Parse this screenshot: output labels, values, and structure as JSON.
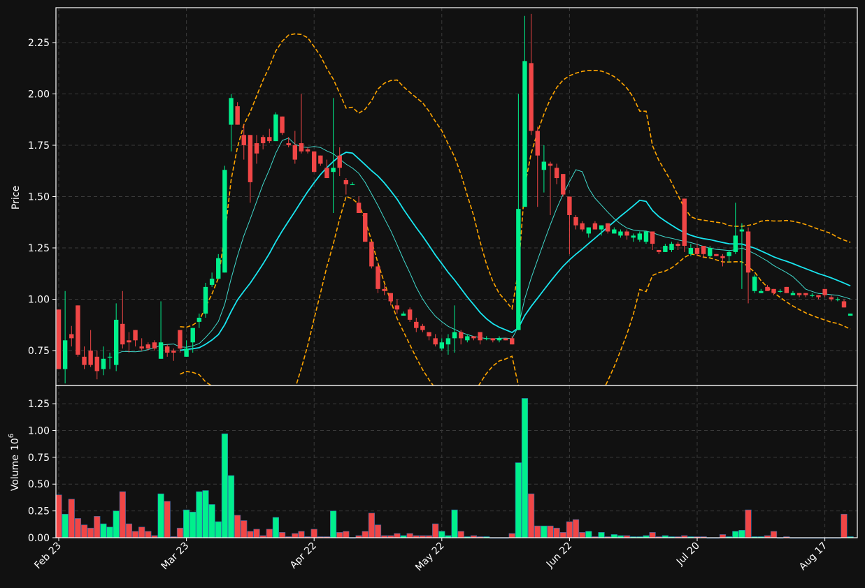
{
  "chart_data": {
    "type": "candlestick",
    "panels": [
      "price",
      "volume"
    ],
    "price_axis": {
      "label": "Price",
      "ticks": [
        "0.75",
        "1.00",
        "1.25",
        "1.50",
        "1.75",
        "2.00",
        "2.25"
      ],
      "ylim": [
        0.58,
        2.42
      ]
    },
    "volume_axis": {
      "label": "Volume",
      "exponent": "10",
      "exponent_power": "6",
      "ticks": [
        "0.00",
        "0.25",
        "0.50",
        "0.75",
        "1.00",
        "1.25"
      ],
      "ylim": [
        0,
        1.42
      ]
    },
    "x_ticks": [
      {
        "label": "Feb 23",
        "index": 0
      },
      {
        "label": "Mar 23",
        "index": 20
      },
      {
        "label": "Apr 22",
        "index": 40
      },
      {
        "label": "May 22",
        "index": 60
      },
      {
        "label": "Jun 22",
        "index": 80
      },
      {
        "label": "Jul 20",
        "index": 100
      },
      {
        "label": "Aug 17",
        "index": 120
      }
    ],
    "colors": {
      "up": "#00f08c",
      "down": "#f04646",
      "ma_slow": "#19e6f0",
      "ma_fast": "#40d9cc",
      "bands": "#ffa500",
      "background": "#111111"
    },
    "candles": [
      [
        0.95,
        0.95,
        0.66,
        0.66,
        0.4
      ],
      [
        0.66,
        1.04,
        0.59,
        0.8,
        0.22
      ],
      [
        0.83,
        0.87,
        0.77,
        0.81,
        0.36
      ],
      [
        0.97,
        0.97,
        0.72,
        0.73,
        0.18
      ],
      [
        0.72,
        0.77,
        0.66,
        0.68,
        0.12
      ],
      [
        0.75,
        0.85,
        0.67,
        0.68,
        0.09
      ],
      [
        0.72,
        0.75,
        0.61,
        0.65,
        0.2
      ],
      [
        0.66,
        0.77,
        0.63,
        0.71,
        0.13
      ],
      [
        0.72,
        0.74,
        0.66,
        0.72,
        0.1
      ],
      [
        0.68,
        0.98,
        0.65,
        0.9,
        0.25
      ],
      [
        0.88,
        1.04,
        0.76,
        0.78,
        0.43
      ],
      [
        0.8,
        0.84,
        0.74,
        0.79,
        0.13
      ],
      [
        0.85,
        0.85,
        0.77,
        0.8,
        0.06
      ],
      [
        0.77,
        0.81,
        0.75,
        0.76,
        0.1
      ],
      [
        0.78,
        0.79,
        0.75,
        0.76,
        0.06
      ],
      [
        0.79,
        0.8,
        0.75,
        0.76,
        0.02
      ],
      [
        0.71,
        0.99,
        0.71,
        0.79,
        0.41
      ],
      [
        0.77,
        0.78,
        0.72,
        0.74,
        0.34
      ],
      [
        0.75,
        0.76,
        0.7,
        0.74,
        0.01
      ],
      [
        0.85,
        0.85,
        0.74,
        0.76,
        0.09
      ],
      [
        0.72,
        0.8,
        0.72,
        0.76,
        0.26
      ],
      [
        0.79,
        0.86,
        0.74,
        0.86,
        0.24
      ],
      [
        0.89,
        0.93,
        0.86,
        0.91,
        0.43
      ],
      [
        0.93,
        1.08,
        0.91,
        1.06,
        0.44
      ],
      [
        1.07,
        1.13,
        1.06,
        1.1,
        0.31
      ],
      [
        1.1,
        1.22,
        1.1,
        1.2,
        0.15
      ],
      [
        1.13,
        1.65,
        1.13,
        1.63,
        0.97
      ],
      [
        1.85,
        2.0,
        1.72,
        1.98,
        0.58
      ],
      [
        1.94,
        1.96,
        1.85,
        1.85,
        0.21
      ],
      [
        1.8,
        1.85,
        1.68,
        1.75,
        0.16
      ],
      [
        1.8,
        1.8,
        1.47,
        1.57,
        0.06
      ],
      [
        1.76,
        1.8,
        1.66,
        1.71,
        0.08
      ],
      [
        1.79,
        1.8,
        1.73,
        1.76,
        0.02
      ],
      [
        1.79,
        1.83,
        1.76,
        1.77,
        0.08
      ],
      [
        1.77,
        1.91,
        1.77,
        1.9,
        0.19
      ],
      [
        1.89,
        1.89,
        1.8,
        1.81,
        0.05
      ],
      [
        1.76,
        1.79,
        1.74,
        1.75,
        0.01
      ],
      [
        1.75,
        1.82,
        1.66,
        1.68,
        0.04
      ],
      [
        1.76,
        2.0,
        1.71,
        1.72,
        0.06
      ],
      [
        1.73,
        1.74,
        1.71,
        1.72,
        0.01
      ],
      [
        1.72,
        1.72,
        1.62,
        1.62,
        0.08
      ],
      [
        1.7,
        1.7,
        1.65,
        1.66,
        0.01
      ],
      [
        1.64,
        1.68,
        1.59,
        1.59,
        0.01
      ],
      [
        1.62,
        1.98,
        1.42,
        1.64,
        0.25
      ],
      [
        1.7,
        1.74,
        1.6,
        1.64,
        0.05
      ],
      [
        1.58,
        1.59,
        1.51,
        1.56,
        0.06
      ],
      [
        1.56,
        1.57,
        1.56,
        1.56,
        0.0
      ],
      [
        1.47,
        1.5,
        1.42,
        1.42,
        0.02
      ],
      [
        1.42,
        1.42,
        1.28,
        1.28,
        0.06
      ],
      [
        1.28,
        1.28,
        1.15,
        1.16,
        0.23
      ],
      [
        1.16,
        1.18,
        1.03,
        1.05,
        0.12
      ],
      [
        1.05,
        1.07,
        1.02,
        1.04,
        0.02
      ],
      [
        1.03,
        1.03,
        0.97,
        0.99,
        0.02
      ],
      [
        0.97,
        1.0,
        0.93,
        0.95,
        0.04
      ],
      [
        0.92,
        0.94,
        0.92,
        0.93,
        0.02
      ],
      [
        0.95,
        0.96,
        0.89,
        0.9,
        0.04
      ],
      [
        0.89,
        0.91,
        0.84,
        0.86,
        0.02
      ],
      [
        0.87,
        0.88,
        0.84,
        0.85,
        0.02
      ],
      [
        0.84,
        0.84,
        0.8,
        0.82,
        0.02
      ],
      [
        0.81,
        0.83,
        0.77,
        0.78,
        0.13
      ],
      [
        0.76,
        0.81,
        0.75,
        0.79,
        0.06
      ],
      [
        0.78,
        0.83,
        0.73,
        0.81,
        0.02
      ],
      [
        0.81,
        0.97,
        0.74,
        0.84,
        0.26
      ],
      [
        0.84,
        0.85,
        0.78,
        0.81,
        0.06
      ],
      [
        0.8,
        0.83,
        0.79,
        0.82,
        0.01
      ],
      [
        0.82,
        0.82,
        0.8,
        0.81,
        0.02
      ],
      [
        0.84,
        0.84,
        0.78,
        0.8,
        0.01
      ],
      [
        0.81,
        0.82,
        0.8,
        0.81,
        0.01
      ],
      [
        0.81,
        0.81,
        0.79,
        0.8,
        0.0
      ],
      [
        0.8,
        0.82,
        0.79,
        0.81,
        0.0
      ],
      [
        0.81,
        0.81,
        0.8,
        0.8,
        0.0
      ],
      [
        0.81,
        0.82,
        0.78,
        0.78,
        0.04
      ],
      [
        0.85,
        2.0,
        0.85,
        1.44,
        0.7
      ],
      [
        1.45,
        2.38,
        1.45,
        2.16,
        1.3
      ],
      [
        2.15,
        2.39,
        1.8,
        1.82,
        0.41
      ],
      [
        1.82,
        1.84,
        1.45,
        1.7,
        0.11
      ],
      [
        1.63,
        1.75,
        1.52,
        1.67,
        0.11
      ],
      [
        1.66,
        1.67,
        1.41,
        1.65,
        0.11
      ],
      [
        1.64,
        1.66,
        1.56,
        1.59,
        0.09
      ],
      [
        1.61,
        1.61,
        1.5,
        1.51,
        0.05
      ],
      [
        1.5,
        1.5,
        1.22,
        1.41,
        0.15
      ],
      [
        1.4,
        1.41,
        1.34,
        1.36,
        0.17
      ],
      [
        1.37,
        1.38,
        1.33,
        1.34,
        0.05
      ],
      [
        1.32,
        1.35,
        1.3,
        1.35,
        0.06
      ],
      [
        1.37,
        1.38,
        1.34,
        1.34,
        0.01
      ],
      [
        1.34,
        1.36,
        1.31,
        1.36,
        0.05
      ],
      [
        1.37,
        1.37,
        1.32,
        1.33,
        0.01
      ],
      [
        1.32,
        1.35,
        1.32,
        1.34,
        0.03
      ],
      [
        1.31,
        1.34,
        1.3,
        1.33,
        0.02
      ],
      [
        1.33,
        1.34,
        1.29,
        1.31,
        0.02
      ],
      [
        1.3,
        1.32,
        1.28,
        1.31,
        0.01
      ],
      [
        1.29,
        1.33,
        1.28,
        1.32,
        0.01
      ],
      [
        1.28,
        1.33,
        1.27,
        1.33,
        0.02
      ],
      [
        1.33,
        1.33,
        1.24,
        1.27,
        0.05
      ],
      [
        1.24,
        1.24,
        1.22,
        1.23,
        0.01
      ],
      [
        1.23,
        1.27,
        1.23,
        1.26,
        0.02
      ],
      [
        1.24,
        1.28,
        1.23,
        1.27,
        0.01
      ],
      [
        1.27,
        1.28,
        1.24,
        1.26,
        0.01
      ],
      [
        1.49,
        1.49,
        1.23,
        1.26,
        0.02
      ],
      [
        1.22,
        1.27,
        1.21,
        1.25,
        0.01
      ],
      [
        1.25,
        1.27,
        1.21,
        1.22,
        0.01
      ],
      [
        1.26,
        1.26,
        1.2,
        1.22,
        0.01
      ],
      [
        1.21,
        1.26,
        1.2,
        1.25,
        0.0
      ],
      [
        1.22,
        1.22,
        1.21,
        1.21,
        0.0
      ],
      [
        1.21,
        1.22,
        1.16,
        1.2,
        0.03
      ],
      [
        1.21,
        1.24,
        1.18,
        1.23,
        0.01
      ],
      [
        1.23,
        1.47,
        1.22,
        1.31,
        0.06
      ],
      [
        1.33,
        1.37,
        1.05,
        1.34,
        0.07
      ],
      [
        1.33,
        1.35,
        0.98,
        1.13,
        0.26
      ],
      [
        1.04,
        1.12,
        1.03,
        1.11,
        0.01
      ],
      [
        1.03,
        1.05,
        1.03,
        1.04,
        0.01
      ],
      [
        1.06,
        1.07,
        1.04,
        1.04,
        0.02
      ],
      [
        1.05,
        1.05,
        1.02,
        1.03,
        0.06
      ],
      [
        1.04,
        1.05,
        1.03,
        1.04,
        0.0
      ],
      [
        1.06,
        1.06,
        1.03,
        1.03,
        0.01
      ],
      [
        1.02,
        1.04,
        1.02,
        1.03,
        0.0
      ],
      [
        1.03,
        1.03,
        1.01,
        1.02,
        0.0
      ],
      [
        1.03,
        1.03,
        1.01,
        1.02,
        0.0
      ],
      [
        1.02,
        1.03,
        1.01,
        1.02,
        0.0
      ],
      [
        1.02,
        1.02,
        1.0,
        1.01,
        0.0
      ],
      [
        1.05,
        1.05,
        1.01,
        1.02,
        0.0
      ],
      [
        1.01,
        1.02,
        0.99,
        1.0,
        0.0
      ],
      [
        1.0,
        1.01,
        0.99,
        1.0,
        0.0
      ],
      [
        0.99,
        1.0,
        0.96,
        0.96,
        0.22
      ],
      [
        0.92,
        0.93,
        0.92,
        0.93,
        0.01
      ]
    ],
    "candle_fields": [
      "open",
      "high",
      "low",
      "close",
      "volume"
    ]
  }
}
